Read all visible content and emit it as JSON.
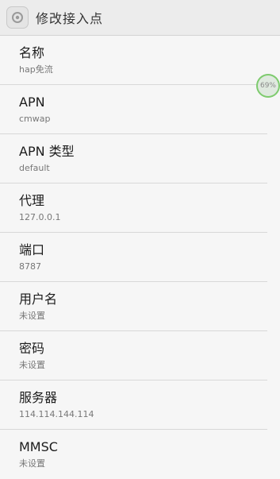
{
  "header": {
    "title": "修改接入点",
    "icon": "settings-gear-icon"
  },
  "items": [
    {
      "title": "名称",
      "value": "hap免流"
    },
    {
      "title": "APN",
      "value": "cmwap"
    },
    {
      "title": "APN 类型",
      "value": "default"
    },
    {
      "title": "代理",
      "value": "127.0.0.1"
    },
    {
      "title": "端口",
      "value": "8787"
    },
    {
      "title": "用户名",
      "value": "未设置"
    },
    {
      "title": "密码",
      "value": "未设置"
    },
    {
      "title": "服务器",
      "value": "114.114.144.114"
    },
    {
      "title": "MMSC",
      "value": "未设置"
    }
  ],
  "overlay": {
    "badge_text": "69%",
    "badge_color": "#7ecb6e"
  }
}
